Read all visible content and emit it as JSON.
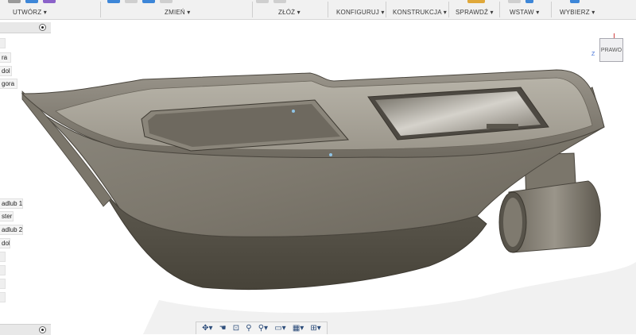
{
  "toolbar": {
    "groups": [
      {
        "id": "create",
        "label": "UTWÓRZ ▾"
      },
      {
        "id": "modify",
        "label": "ZMIEŃ ▾"
      },
      {
        "id": "assemble",
        "label": "ZŁÓŻ ▾"
      },
      {
        "id": "configure",
        "label": "KONFIGURUJ ▾"
      },
      {
        "id": "construct",
        "label": "KONSTRUKCJA ▾"
      },
      {
        "id": "inspect",
        "label": "SPRAWDŹ ▾"
      },
      {
        "id": "insert",
        "label": "WSTAW ▾"
      },
      {
        "id": "select",
        "label": "WYBIERZ ▾"
      }
    ],
    "accent_colors": {
      "blue": "#3d86d8",
      "purple": "#8b62c9",
      "gray": "#9a9a9a"
    }
  },
  "browser": {
    "items_top": [
      "ra",
      "dol",
      "gora"
    ],
    "items_bottom": [
      "adlub 1",
      "ster",
      "adlub 2",
      "dol"
    ]
  },
  "viewcube": {
    "face_label": "PRAWO",
    "axis_z": "Z"
  },
  "nav_icons": [
    "orbit-icon",
    "pan-icon",
    "look-at-icon",
    "zoom-icon",
    "zoom-window-icon",
    "display-settings-icon",
    "grid-icon",
    "viewports-icon"
  ]
}
